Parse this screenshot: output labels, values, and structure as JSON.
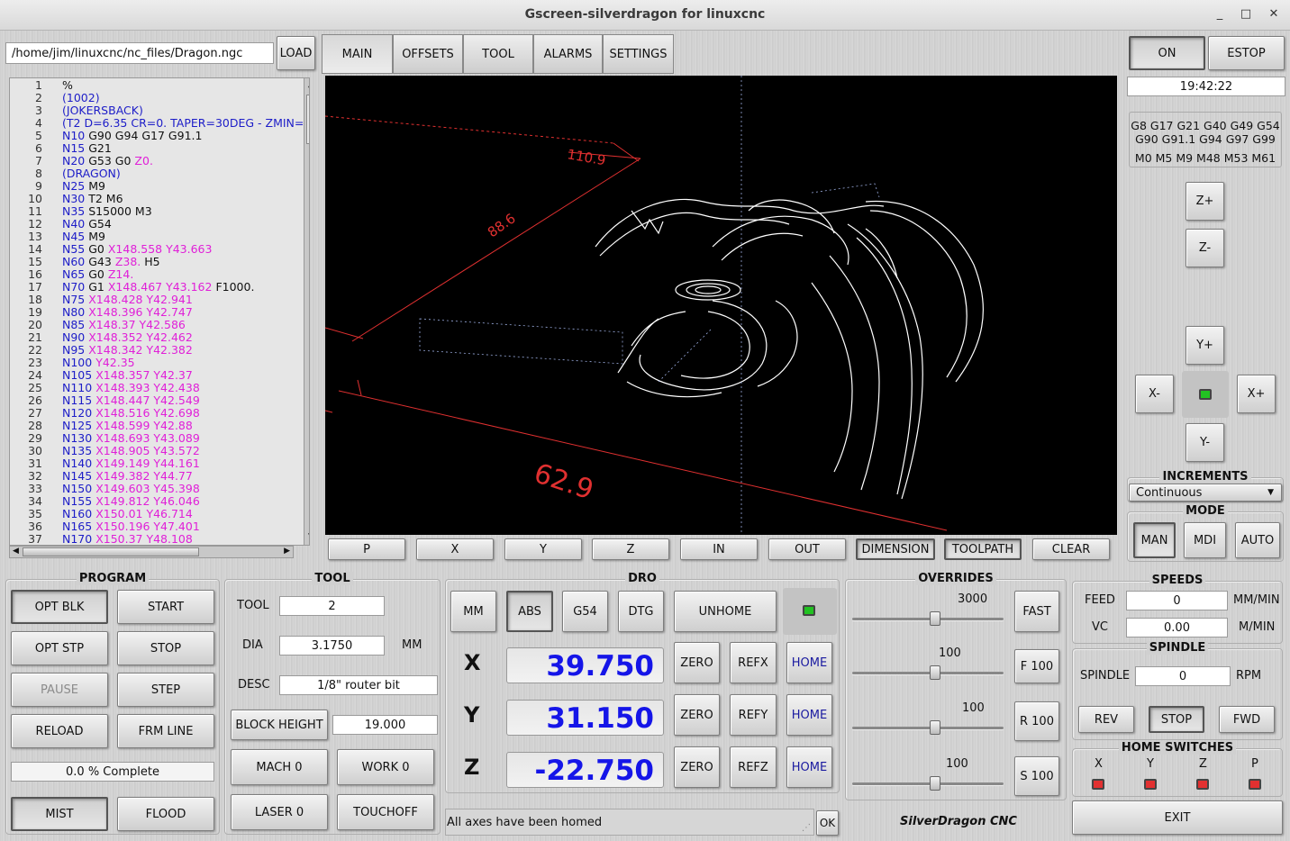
{
  "window": {
    "title": "Gscreen-silverdragon for linuxcnc",
    "min": "_",
    "max": "□",
    "close": "✕"
  },
  "file": {
    "path": "/home/jim/linuxcnc/nc_files/Dragon.ngc",
    "load_label": "LOAD"
  },
  "tabs": [
    "MAIN",
    "OFFSETS",
    "TOOL",
    "ALARMS",
    "SETTINGS"
  ],
  "power": {
    "on": "ON",
    "estop": "ESTOP"
  },
  "clock": "19:42:22",
  "gcodes": {
    "line1": "G8 G17 G21 G40 G49 G54",
    "line2": "G90 G91.1 G94 G97 G99",
    "mcodes": "M0 M5 M9 M48 M53 M61"
  },
  "jog": {
    "zplus": "Z+",
    "zminus": "Z-",
    "yplus": "Y+",
    "yminus": "Y-",
    "xminus": "X-",
    "xplus": "X+"
  },
  "increments": {
    "title": "INCREMENTS",
    "value": "Continuous"
  },
  "mode": {
    "title": "MODE",
    "man": "MAN",
    "mdi": "MDI",
    "auto": "AUTO"
  },
  "code_lines": [
    {
      "n": "1",
      "parts": [
        {
          "t": "%",
          "c": "blk"
        }
      ]
    },
    {
      "n": "2",
      "parts": [
        {
          "t": "(1002)",
          "c": "blue"
        }
      ]
    },
    {
      "n": "3",
      "parts": [
        {
          "t": "(JOKERSBACK)",
          "c": "blue"
        }
      ]
    },
    {
      "n": "4",
      "parts": [
        {
          "t": "(T2  D=6.35 CR=0. TAPER=30DEG - ZMIN=",
          "c": "blue"
        }
      ]
    },
    {
      "n": "5",
      "parts": [
        {
          "t": "N10 ",
          "c": "blue"
        },
        {
          "t": "G90 G94 G17 G91.1",
          "c": "blk"
        }
      ]
    },
    {
      "n": "6",
      "parts": [
        {
          "t": "N15 ",
          "c": "blue"
        },
        {
          "t": "G21",
          "c": "blk"
        }
      ]
    },
    {
      "n": "7",
      "parts": [
        {
          "t": "N20 ",
          "c": "blue"
        },
        {
          "t": "G53 G0 ",
          "c": "blk"
        },
        {
          "t": "Z0.",
          "c": "mag"
        }
      ]
    },
    {
      "n": "8",
      "parts": [
        {
          "t": "(DRAGON)",
          "c": "blue"
        }
      ]
    },
    {
      "n": "9",
      "parts": [
        {
          "t": "N25 ",
          "c": "blue"
        },
        {
          "t": "M9",
          "c": "blk"
        }
      ]
    },
    {
      "n": "10",
      "parts": [
        {
          "t": "N30 ",
          "c": "blue"
        },
        {
          "t": "T2 M6",
          "c": "blk"
        }
      ]
    },
    {
      "n": "11",
      "parts": [
        {
          "t": "N35 ",
          "c": "blue"
        },
        {
          "t": "S15000 M3",
          "c": "blk"
        }
      ]
    },
    {
      "n": "12",
      "parts": [
        {
          "t": "N40 ",
          "c": "blue"
        },
        {
          "t": "G54",
          "c": "blk"
        }
      ]
    },
    {
      "n": "13",
      "parts": [
        {
          "t": "N45 ",
          "c": "blue"
        },
        {
          "t": "M9",
          "c": "blk"
        }
      ]
    },
    {
      "n": "14",
      "parts": [
        {
          "t": "N55 ",
          "c": "blue"
        },
        {
          "t": "G0 ",
          "c": "blk"
        },
        {
          "t": "X148.558 Y43.663",
          "c": "mag"
        }
      ]
    },
    {
      "n": "15",
      "parts": [
        {
          "t": "N60 ",
          "c": "blue"
        },
        {
          "t": "G43 ",
          "c": "blk"
        },
        {
          "t": "Z38.",
          "c": "mag"
        },
        {
          "t": " H5",
          "c": "blk"
        }
      ]
    },
    {
      "n": "16",
      "parts": [
        {
          "t": "N65 ",
          "c": "blue"
        },
        {
          "t": "G0 ",
          "c": "blk"
        },
        {
          "t": "Z14.",
          "c": "mag"
        }
      ]
    },
    {
      "n": "17",
      "parts": [
        {
          "t": "N70 ",
          "c": "blue"
        },
        {
          "t": "G1 ",
          "c": "blk"
        },
        {
          "t": "X148.467 Y43.162",
          "c": "mag"
        },
        {
          "t": " F1000.",
          "c": "blk"
        }
      ]
    },
    {
      "n": "18",
      "parts": [
        {
          "t": "N75 ",
          "c": "blue"
        },
        {
          "t": "X148.428 Y42.941",
          "c": "mag"
        }
      ]
    },
    {
      "n": "19",
      "parts": [
        {
          "t": "N80 ",
          "c": "blue"
        },
        {
          "t": "X148.396 Y42.747",
          "c": "mag"
        }
      ]
    },
    {
      "n": "20",
      "parts": [
        {
          "t": "N85 ",
          "c": "blue"
        },
        {
          "t": "X148.37 Y42.586",
          "c": "mag"
        }
      ]
    },
    {
      "n": "21",
      "parts": [
        {
          "t": "N90 ",
          "c": "blue"
        },
        {
          "t": "X148.352 Y42.462",
          "c": "mag"
        }
      ]
    },
    {
      "n": "22",
      "parts": [
        {
          "t": "N95 ",
          "c": "blue"
        },
        {
          "t": "X148.342 Y42.382",
          "c": "mag"
        }
      ]
    },
    {
      "n": "23",
      "parts": [
        {
          "t": "N100 ",
          "c": "blue"
        },
        {
          "t": "Y42.35",
          "c": "mag"
        }
      ]
    },
    {
      "n": "24",
      "parts": [
        {
          "t": "N105 ",
          "c": "blue"
        },
        {
          "t": "X148.357 Y42.37",
          "c": "mag"
        }
      ]
    },
    {
      "n": "25",
      "parts": [
        {
          "t": "N110 ",
          "c": "blue"
        },
        {
          "t": "X148.393 Y42.438",
          "c": "mag"
        }
      ]
    },
    {
      "n": "26",
      "parts": [
        {
          "t": "N115 ",
          "c": "blue"
        },
        {
          "t": "X148.447 Y42.549",
          "c": "mag"
        }
      ]
    },
    {
      "n": "27",
      "parts": [
        {
          "t": "N120 ",
          "c": "blue"
        },
        {
          "t": "X148.516 Y42.698",
          "c": "mag"
        }
      ]
    },
    {
      "n": "28",
      "parts": [
        {
          "t": "N125 ",
          "c": "blue"
        },
        {
          "t": "X148.599 Y42.88",
          "c": "mag"
        }
      ]
    },
    {
      "n": "29",
      "parts": [
        {
          "t": "N130 ",
          "c": "blue"
        },
        {
          "t": "X148.693 Y43.089",
          "c": "mag"
        }
      ]
    },
    {
      "n": "30",
      "parts": [
        {
          "t": "N135 ",
          "c": "blue"
        },
        {
          "t": "X148.905 Y43.572",
          "c": "mag"
        }
      ]
    },
    {
      "n": "31",
      "parts": [
        {
          "t": "N140 ",
          "c": "blue"
        },
        {
          "t": "X149.149 Y44.161",
          "c": "mag"
        }
      ]
    },
    {
      "n": "32",
      "parts": [
        {
          "t": "N145 ",
          "c": "blue"
        },
        {
          "t": "X149.382 Y44.77",
          "c": "mag"
        }
      ]
    },
    {
      "n": "33",
      "parts": [
        {
          "t": "N150 ",
          "c": "blue"
        },
        {
          "t": "X149.603 Y45.398",
          "c": "mag"
        }
      ]
    },
    {
      "n": "34",
      "parts": [
        {
          "t": "N155 ",
          "c": "blue"
        },
        {
          "t": "X149.812 Y46.046",
          "c": "mag"
        }
      ]
    },
    {
      "n": "35",
      "parts": [
        {
          "t": "N160 ",
          "c": "blue"
        },
        {
          "t": "X150.01 Y46.714",
          "c": "mag"
        }
      ]
    },
    {
      "n": "36",
      "parts": [
        {
          "t": "N165 ",
          "c": "blue"
        },
        {
          "t": "X150.196 Y47.401",
          "c": "mag"
        }
      ]
    },
    {
      "n": "37",
      "parts": [
        {
          "t": "N170 ",
          "c": "blue"
        },
        {
          "t": "X150.37 Y48.108",
          "c": "mag"
        }
      ]
    }
  ],
  "preview": {
    "dim_x": "110.9",
    "dim_y": "88.6",
    "dim_z": "62.9"
  },
  "view_buttons": [
    "P",
    "X",
    "Y",
    "Z",
    "IN",
    "OUT",
    "DIMENSION",
    "TOOLPATH",
    "CLEAR"
  ],
  "program": {
    "title": "PROGRAM",
    "opt_blk": "OPT BLK",
    "start": "START",
    "opt_stp": "OPT STP",
    "stop": "STOP",
    "pause": "PAUSE",
    "step": "STEP",
    "reload": "RELOAD",
    "frm_line": "FRM LINE",
    "progress": "0.0 % Complete",
    "mist": "MIST",
    "flood": "FLOOD"
  },
  "tool": {
    "title": "TOOL",
    "tool_label": "TOOL",
    "tool_value": "2",
    "dia_label": "DIA",
    "dia_value": "3.1750",
    "dia_unit": "MM",
    "desc_label": "DESC",
    "desc_value": "1/8\" router bit",
    "block_height_label": "BLOCK HEIGHT",
    "block_height_value": "19.000",
    "mach0": "MACH 0",
    "work0": "WORK 0",
    "laser0": "LASER 0",
    "touchoff": "TOUCHOFF"
  },
  "dro": {
    "title": "DRO",
    "mm": "MM",
    "abs": "ABS",
    "g54": "G54",
    "dtg": "DTG",
    "unhome": "UNHOME",
    "axes": [
      {
        "name": "X",
        "value": "39.750",
        "zero": "ZERO",
        "ref": "REFX",
        "home": "HOME"
      },
      {
        "name": "Y",
        "value": "31.150",
        "zero": "ZERO",
        "ref": "REFY",
        "home": "HOME"
      },
      {
        "name": "Z",
        "value": "-22.750",
        "zero": "ZERO",
        "ref": "REFZ",
        "home": "HOME"
      }
    ]
  },
  "overrides": {
    "title": "OVERRIDES",
    "rapid_value": "3000",
    "fast": "FAST",
    "feed_value": "100",
    "feed_btn": "F 100",
    "rapid_pct_value": "100",
    "rapid_btn": "R 100",
    "spindle_value": "100",
    "spindle_btn": "S 100",
    "levels": {
      "rapid": 0.55,
      "feed": 0.55,
      "rapid_pct": 0.55,
      "spindle": 0.55
    }
  },
  "status": {
    "message": "All axes have been homed",
    "ok": "OK",
    "brand": "SilverDragon CNC"
  },
  "speeds": {
    "title": "SPEEDS",
    "feed_label": "FEED",
    "feed_value": "0",
    "feed_unit": "MM/MIN",
    "vc_label": "VC",
    "vc_value": "0.00",
    "vc_unit": "M/MIN"
  },
  "spindle": {
    "title": "SPINDLE",
    "label": "SPINDLE",
    "value": "0",
    "unit": "RPM",
    "rev": "REV",
    "stop": "STOP",
    "fwd": "FWD"
  },
  "home_switches": {
    "title": "HOME SWITCHES",
    "labels": [
      "X",
      "Y",
      "Z",
      "P"
    ]
  },
  "exit": "EXIT",
  "colors": {
    "dro_value": "#1515e8",
    "code_blue": "#1d1dc8",
    "code_magenta": "#e020d8",
    "led_red": "#e23030",
    "led_green": "#22c222"
  }
}
